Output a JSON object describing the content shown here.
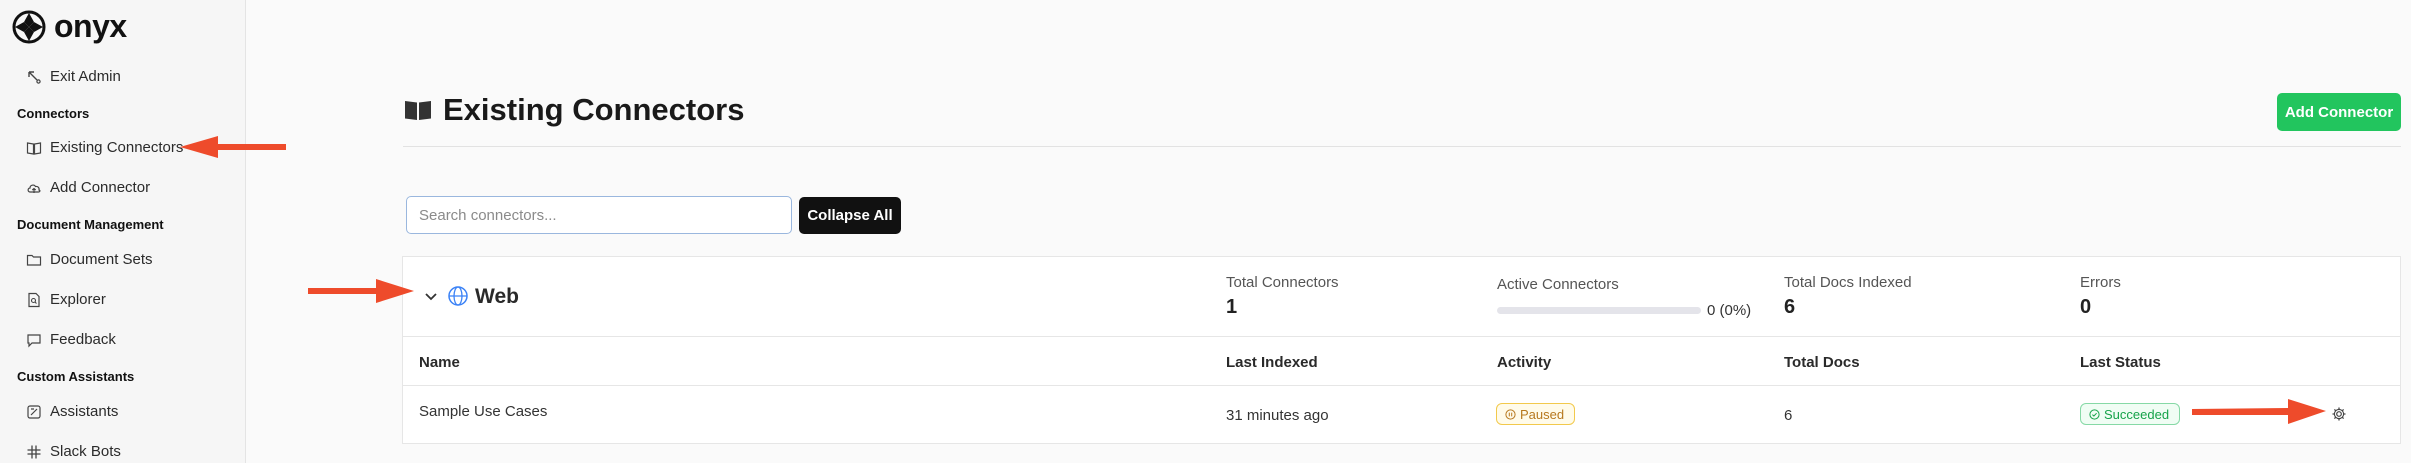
{
  "brand": {
    "name": "onyx"
  },
  "sidebar": {
    "exit_admin": "Exit Admin",
    "sections": [
      {
        "title": "Connectors",
        "items": [
          {
            "label": "Existing Connectors",
            "icon": "book-icon"
          },
          {
            "label": "Add Connector",
            "icon": "cloud-upload-icon"
          }
        ]
      },
      {
        "title": "Document Management",
        "items": [
          {
            "label": "Document Sets",
            "icon": "folder-icon"
          },
          {
            "label": "Explorer",
            "icon": "file-search-icon"
          },
          {
            "label": "Feedback",
            "icon": "message-icon"
          }
        ]
      },
      {
        "title": "Custom Assistants",
        "items": [
          {
            "label": "Assistants",
            "icon": "assistant-icon"
          },
          {
            "label": "Slack Bots",
            "icon": "slack-icon"
          }
        ]
      }
    ]
  },
  "main": {
    "title": "Existing Connectors",
    "add_button": "Add Connector",
    "search_placeholder": "Search connectors...",
    "collapse_button": "Collapse All"
  },
  "group": {
    "name": "Web",
    "stats": {
      "total_connectors_label": "Total Connectors",
      "total_connectors_value": "1",
      "active_connectors_label": "Active Connectors",
      "active_connectors_text": "0 (0%)",
      "active_fraction": 0,
      "total_docs_label": "Total Docs Indexed",
      "total_docs_value": "6",
      "errors_label": "Errors",
      "errors_value": "0"
    },
    "columns": [
      "Name",
      "Last Indexed",
      "Activity",
      "Total Docs",
      "Last Status"
    ],
    "rows": [
      {
        "name": "Sample Use Cases",
        "last_indexed": "31 minutes ago",
        "activity": "Paused",
        "total_docs": "6",
        "last_status": "Succeeded"
      }
    ]
  },
  "colors": {
    "accent": "#22c55e",
    "annotation_arrow": "#ee4b2b",
    "paused": "#b7791f",
    "succeeded": "#16a34a"
  }
}
